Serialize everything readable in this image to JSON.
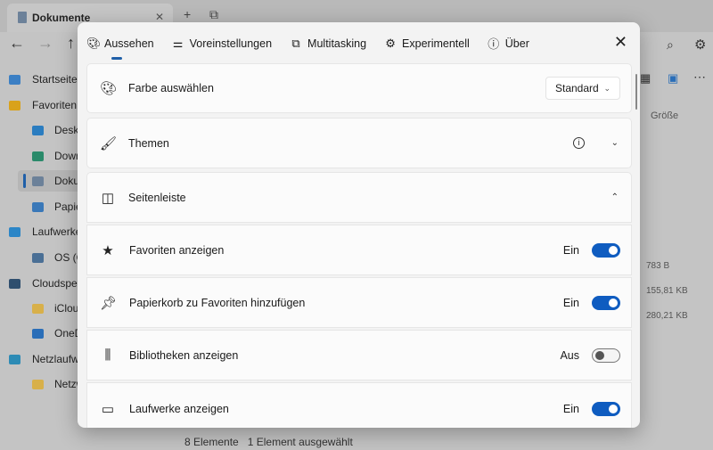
{
  "explorer": {
    "tab_title": "Dokumente",
    "sidebar": [
      {
        "label": "Startseite",
        "color": "#3b7fc4"
      },
      {
        "label": "Favoriten",
        "color": "#d9a21b"
      },
      {
        "label": "Deskt",
        "color": "#2b7dc0"
      },
      {
        "label": "Down",
        "color": "#2a8a6a"
      },
      {
        "label": "Doku",
        "color": "#6c8199"
      },
      {
        "label": "Papie",
        "color": "#3a78b8"
      },
      {
        "label": "Laufwerke",
        "color": "#2c86c7"
      },
      {
        "label": "OS (C",
        "color": "#4a6f95"
      },
      {
        "label": "Cloudspei",
        "color": "#2f4f6e"
      },
      {
        "label": "iClou",
        "color": "#d8b04a"
      },
      {
        "label": "OneD",
        "color": "#2a6eb8"
      },
      {
        "label": "Netzlaufw",
        "color": "#2d8bb5"
      },
      {
        "label": "Netzw",
        "color": "#d8b04a"
      }
    ],
    "column_size": "Größe",
    "sizes": [
      "783 B",
      "155,81 KB",
      "280,21 KB"
    ],
    "status": {
      "count": "8 Elemente",
      "selected": "1 Element ausgewählt"
    }
  },
  "dialog": {
    "tabs": [
      {
        "label": "Aussehen",
        "icon": "palette-icon",
        "glyph": "🎨︎"
      },
      {
        "label": "Voreinstellungen",
        "icon": "sliders-icon",
        "glyph": "⚌"
      },
      {
        "label": "Multitasking",
        "icon": "windows-icon",
        "glyph": "⧉"
      },
      {
        "label": "Experimentell",
        "icon": "flask-icon",
        "glyph": "⚙"
      },
      {
        "label": "Über",
        "icon": "info-icon",
        "glyph": "ⓘ"
      }
    ],
    "rows": {
      "color": {
        "label": "Farbe auswählen",
        "value": "Standard"
      },
      "themes": {
        "label": "Themen"
      },
      "sidebar": {
        "label": "Seitenleiste"
      },
      "favorites": {
        "label": "Favoriten anzeigen",
        "state": "Ein"
      },
      "recycle": {
        "label": "Papierkorb zu Favoriten hinzufügen",
        "state": "Ein"
      },
      "libraries": {
        "label": "Bibliotheken anzeigen",
        "state": "Aus"
      },
      "drives": {
        "label": "Laufwerke anzeigen",
        "state": "Ein"
      }
    },
    "accent": "#0f5cc0"
  }
}
